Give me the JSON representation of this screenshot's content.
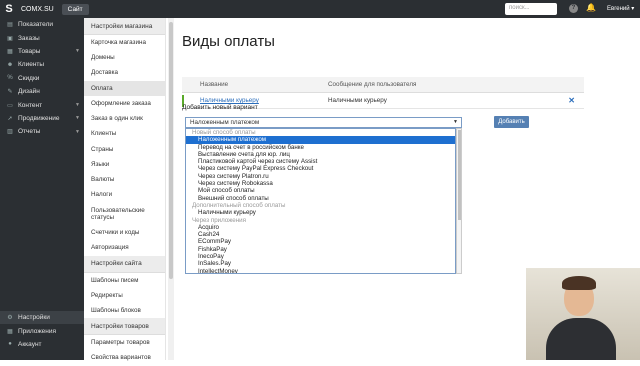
{
  "topbar": {
    "brand": "COMX.SU",
    "site_button": "Сайт",
    "search_placeholder": "поиск...",
    "user": "Евгений"
  },
  "sidebar": {
    "items": [
      {
        "label": "Показатели",
        "icon": "dashboard-icon",
        "chevron": false
      },
      {
        "label": "Заказы",
        "icon": "orders-icon",
        "chevron": false
      },
      {
        "label": "Товары",
        "icon": "products-icon",
        "chevron": true
      },
      {
        "label": "Клиенты",
        "icon": "clients-icon",
        "chevron": false
      },
      {
        "label": "Скидки",
        "icon": "discounts-icon",
        "chevron": false
      },
      {
        "label": "Дизайн",
        "icon": "design-icon",
        "chevron": false
      },
      {
        "label": "Контент",
        "icon": "content-icon",
        "chevron": true
      },
      {
        "label": "Продвижение",
        "icon": "promotion-icon",
        "chevron": true
      },
      {
        "label": "Отчеты",
        "icon": "reports-icon",
        "chevron": true
      }
    ],
    "bottom_items": [
      {
        "label": "Настройки",
        "icon": "gear-icon"
      },
      {
        "label": "Приложения",
        "icon": "apps-icon"
      },
      {
        "label": "Аккаунт",
        "icon": "account-icon"
      }
    ]
  },
  "submenu": {
    "section1": "Настройки магазина",
    "items1": [
      "Карточка магазина",
      "Домены",
      "Доставка",
      "Оплата",
      "Оформление заказа",
      "Заказ в один клик",
      "Клиенты",
      "Страны",
      "Языки",
      "Валюты",
      "Налоги",
      "Пользовательские статусы",
      "Счетчики и коды",
      "Авторизация"
    ],
    "section2": "Настройки сайта",
    "items2": [
      "Шаблоны писем",
      "Редиректы",
      "Шаблоны блоков"
    ],
    "section3": "Настройки товаров",
    "items3": [
      "Параметры товаров",
      "Свойства вариантов"
    ]
  },
  "main": {
    "title": "Виды оплаты",
    "col_name": "Название",
    "col_message": "Сообщение для пользователя",
    "row_name": "Наличными курьеру",
    "row_message": "Наличными курьеру",
    "add_label": "Добавить новый вариант",
    "select_value": "Наложенным платежом",
    "add_button": "Добавить"
  },
  "dropdown": [
    {
      "group": "Новый способ оплаты"
    },
    {
      "opt": "Наложенным платежом",
      "sel": true
    },
    {
      "opt": "Перевод на счет в российском банке"
    },
    {
      "opt": "Выставление счета для юр. лиц"
    },
    {
      "opt": "Пластиковой картой через систему Assist"
    },
    {
      "opt": "Через систему PayPal Express Checkout"
    },
    {
      "opt": "Через систему Platron.ru"
    },
    {
      "opt": "Через систему Robokassa"
    },
    {
      "opt": "Мой способ оплаты"
    },
    {
      "opt": "Внешний способ оплаты"
    },
    {
      "group": "Дополнительный способ оплаты"
    },
    {
      "opt": "Наличными курьеру"
    },
    {
      "group": "Через приложения"
    },
    {
      "opt": "Acquiro"
    },
    {
      "opt": "Cash24"
    },
    {
      "opt": "ECommPay"
    },
    {
      "opt": "FishkaPay"
    },
    {
      "opt": "InecoPay"
    },
    {
      "opt": "InSales.Pay"
    },
    {
      "opt": "IntellectMoney"
    }
  ]
}
